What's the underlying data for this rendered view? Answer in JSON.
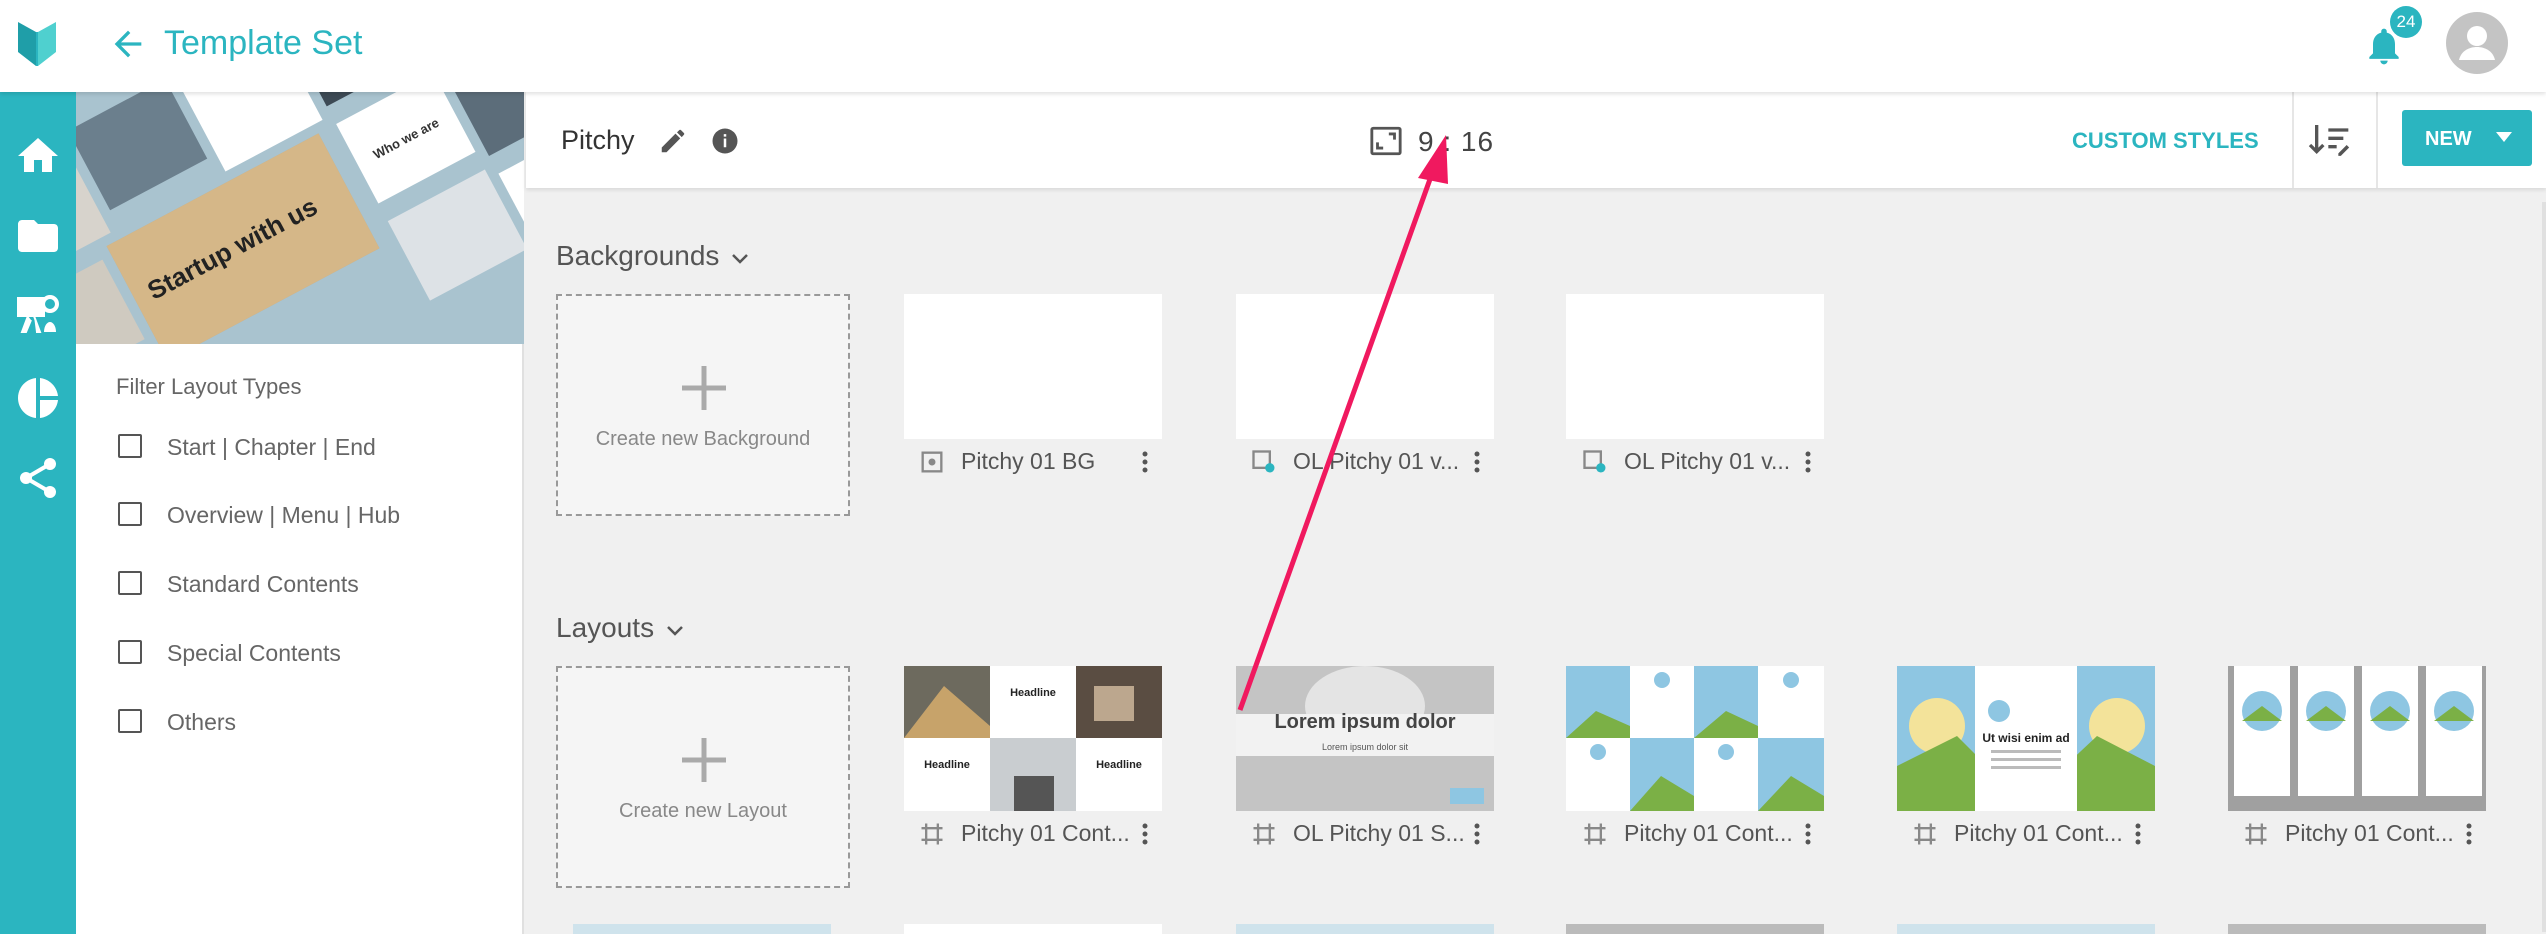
{
  "app": {
    "title": "Template Set",
    "notifications_count": "24",
    "accent": "#2bb5c0"
  },
  "rail": {
    "items": [
      "home-icon",
      "folder-icon",
      "presentation-icon",
      "pie-chart-icon",
      "share-icon"
    ]
  },
  "sidebar": {
    "filter_title": "Filter Layout Types",
    "filters": [
      {
        "label": "Start | Chapter | End",
        "checked": false
      },
      {
        "label": "Overview | Menu | Hub",
        "checked": false
      },
      {
        "label": "Standard Contents",
        "checked": false
      },
      {
        "label": "Special Contents",
        "checked": false
      },
      {
        "label": "Others",
        "checked": false
      }
    ]
  },
  "toolbar": {
    "set_name": "Pitchy",
    "aspect_ratio": "9 : 16",
    "custom_styles_label": "CUSTOM STYLES",
    "new_label": "NEW"
  },
  "backgrounds": {
    "title": "Backgrounds",
    "create_label": "Create new Background",
    "items": [
      {
        "label": "Pitchy 01 BG"
      },
      {
        "label": "OL Pitchy 01 v..."
      },
      {
        "label": "OL Pitchy 01 v..."
      }
    ]
  },
  "layouts": {
    "title": "Layouts",
    "create_label": "Create new Layout",
    "items": [
      {
        "label": "Pitchy 01 Cont..."
      },
      {
        "label": "OL Pitchy 01 S..."
      },
      {
        "label": "Pitchy 01 Cont..."
      },
      {
        "label": "Pitchy 01 Cont..."
      },
      {
        "label": "Pitchy 01 Cont..."
      }
    ]
  },
  "thumb_text": {
    "hero_title": "Startup with us",
    "headline": "Headline",
    "lorem_title": "Lorem ipsum dolor",
    "lorem_sub": "Lorem ipsum dolor sit",
    "ut_title": "Ut wisi enim ad",
    "who": "Who we are"
  }
}
